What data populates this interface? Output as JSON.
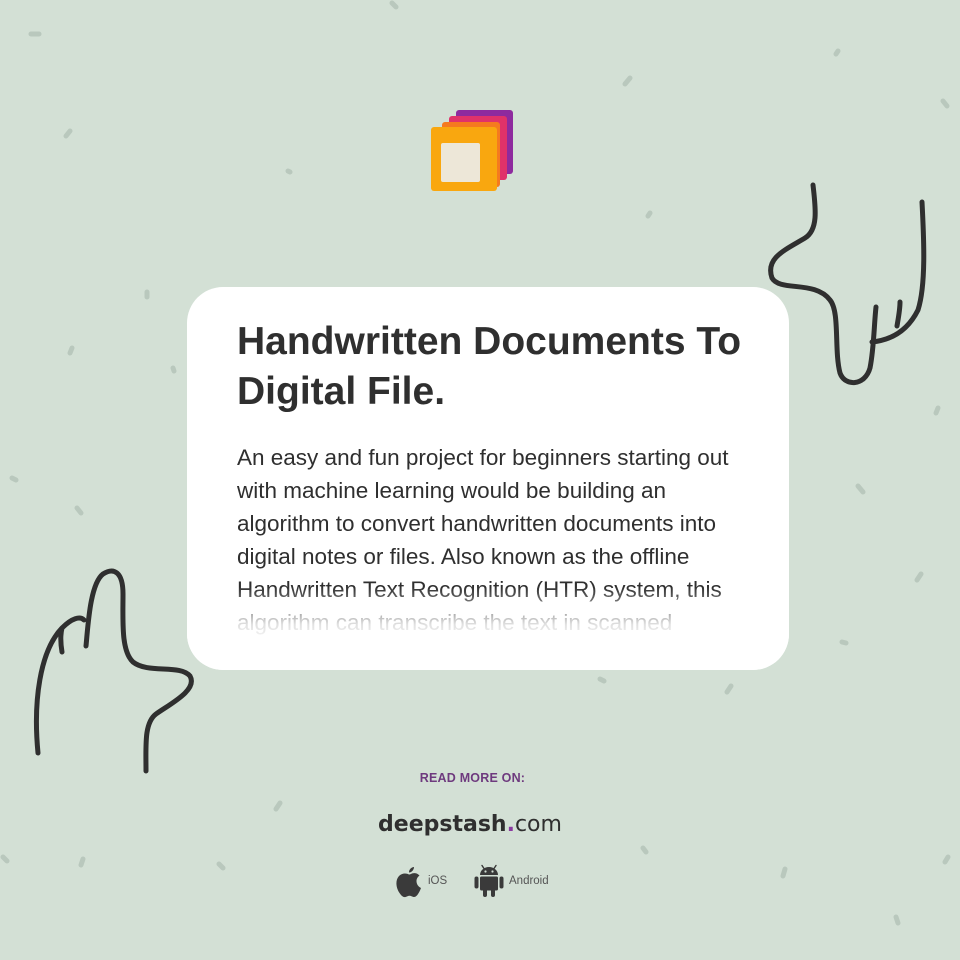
{
  "logo": {
    "icon": "stacked-squares-logo",
    "colors": [
      "#8e2a9e",
      "#e0326a",
      "#f57a1f",
      "#f9a70f"
    ]
  },
  "card": {
    "title": "Handwritten Documents To Digital File.",
    "body": "An easy and fun project for beginners starting out with machine learning would be building an algorithm to convert handwritten documents into digital notes or files. Also known as the offline Handwritten Text Recognition (HTR) system, this algorithm can transcribe the text in scanned"
  },
  "footer": {
    "read_more_label": "READ MORE ON:",
    "brand_name": "deepstash",
    "brand_dot": ".",
    "brand_tld": "com",
    "ios_label": "iOS",
    "android_label": "Android",
    "ios_icon": "apple-icon",
    "android_icon": "android-icon"
  },
  "colors": {
    "background": "#d3e0d5",
    "card": "#ffffff",
    "text": "#2f2f2f",
    "accent": "#6e3a7e"
  }
}
